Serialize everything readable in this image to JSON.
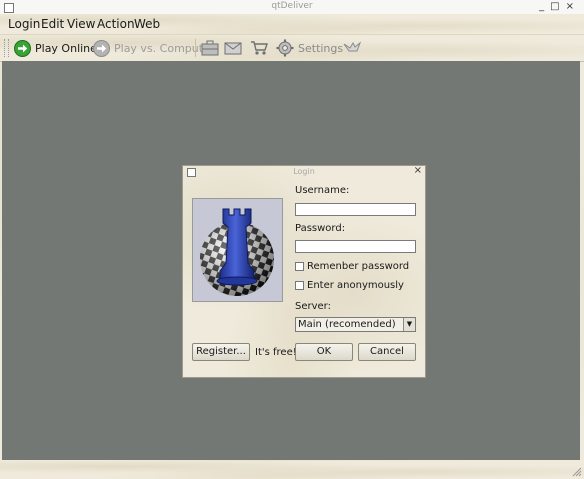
{
  "window": {
    "title": "qtDeliver"
  },
  "menu": {
    "items": [
      "Login",
      "Edit",
      "View",
      "Action",
      "Web"
    ]
  },
  "toolbar": {
    "play_online": "Play Online",
    "play_computer": "Play vs. Computer",
    "settings": "Settings"
  },
  "dialog": {
    "title": "Login",
    "username_label": "Username:",
    "username_value": "",
    "password_label": "Password:",
    "password_value": "",
    "remember_label": "Remenber password",
    "anon_label": "Enter anonymously",
    "server_label": "Server:",
    "server_value": "Main (recomended)",
    "register_label": "Register...",
    "free_text": "It's free!",
    "ok_label": "OK",
    "cancel_label": "Cancel"
  },
  "icons": [
    "arrow-right-icon",
    "arrow-right-icon",
    "briefcase-icon",
    "mail-icon",
    "cart-icon",
    "gear-icon",
    "bird-icon",
    "chess-rook-icon"
  ],
  "colors": {
    "workspace": "#747874",
    "rook": "#2b3fa8",
    "play_online": "#3aa336"
  }
}
